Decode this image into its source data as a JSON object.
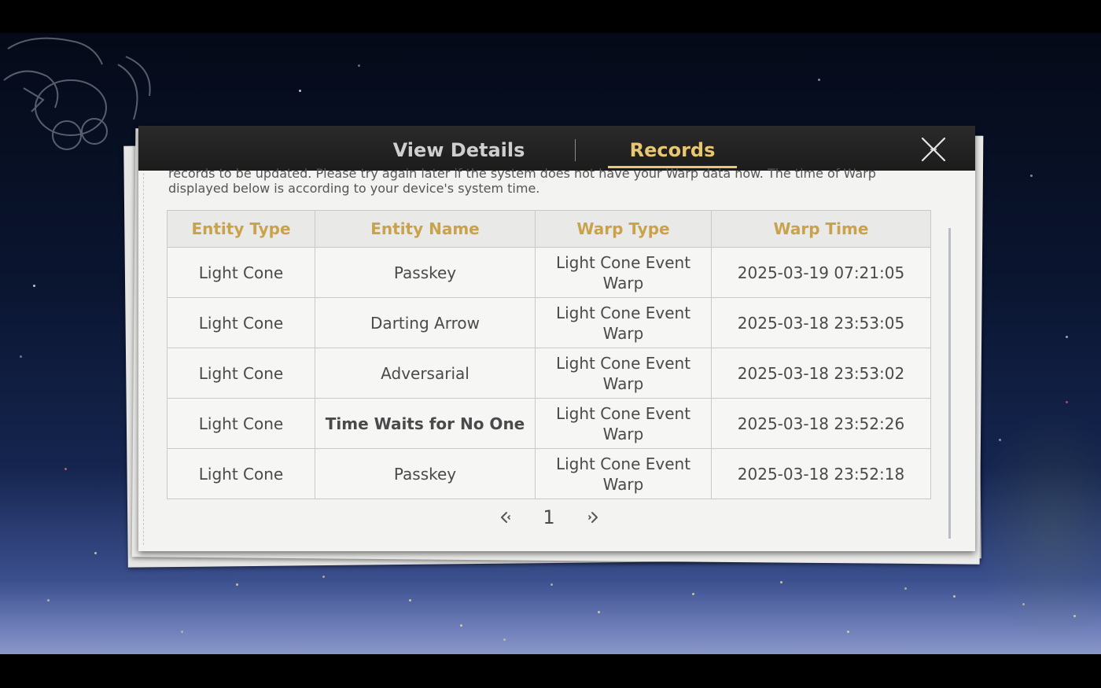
{
  "tabs": {
    "view_details": "View Details",
    "records": "Records",
    "active": "Records"
  },
  "notice": {
    "line1": "records to be updated. Please try again later if the system does not have your Warp data now. The time of Warp",
    "line2": "displayed below is according to your device's system time."
  },
  "table": {
    "headers": [
      "Entity Type",
      "Entity Name",
      "Warp Type",
      "Warp Time"
    ],
    "rows": [
      {
        "entity_type": "Light Cone",
        "entity_name": "Passkey",
        "warp_type_1": "Light Cone Event",
        "warp_type_2": "Warp",
        "warp_time": "2025-03-19 07:21:05"
      },
      {
        "entity_type": "Light Cone",
        "entity_name": "Darting Arrow",
        "warp_type_1": "Light Cone Event",
        "warp_type_2": "Warp",
        "warp_time": "2025-03-18 23:53:05"
      },
      {
        "entity_type": "Light Cone",
        "entity_name": "Adversarial",
        "warp_type_1": "Light Cone Event",
        "warp_type_2": "Warp",
        "warp_time": "2025-03-18 23:53:02"
      },
      {
        "entity_type": "Light Cone",
        "entity_name": "Time Waits for No One",
        "warp_type_1": "Light Cone Event",
        "warp_type_2": "Warp",
        "warp_time": "2025-03-18 23:52:26"
      },
      {
        "entity_type": "Light Cone",
        "entity_name": "Passkey",
        "warp_type_1": "Light Cone Event",
        "warp_type_2": "Warp",
        "warp_time": "2025-03-18 23:52:18"
      }
    ]
  },
  "pagination": {
    "current_page": "1"
  },
  "colors": {
    "accent_gold": "#e9c772",
    "header_gold": "#c9a24a",
    "highlight_orange": "#e0a83c",
    "header_bar": "#222222",
    "paper": "#f3f3f1"
  },
  "icons": {
    "close": "close-icon",
    "prev": "chevron-left-icon",
    "next": "chevron-right-icon"
  }
}
